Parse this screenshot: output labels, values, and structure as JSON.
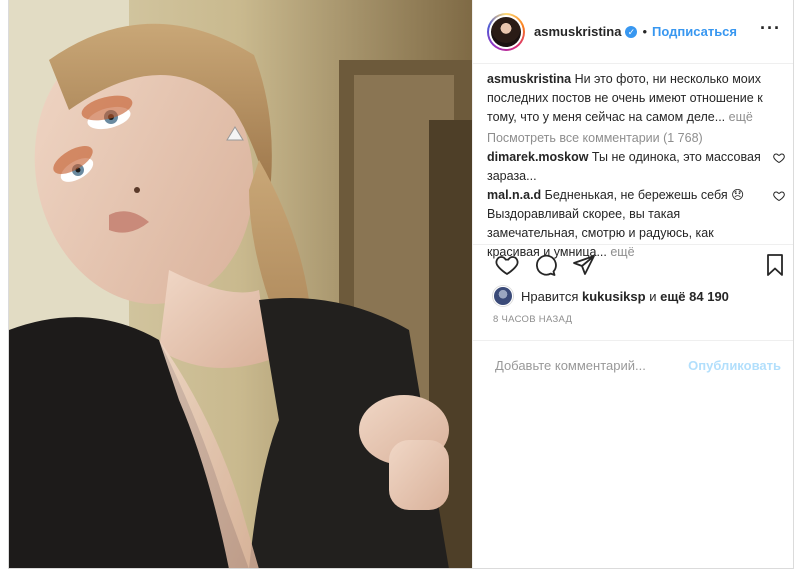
{
  "post": {
    "username": "asmuskristina",
    "verified_icon": "verified-badge-icon",
    "separator": "•",
    "follow_label": "Подписаться",
    "more_options": "···",
    "caption_user": "asmuskristina",
    "caption_text": "Ни это фото, ни несколько моих последних постов не очень имеют отношение к тому, что у меня сейчас на самом деле...",
    "caption_more": "ещё",
    "view_all_comments": "Посмотреть все комментарии (1 768)",
    "comments": [
      {
        "user": "dimarek.moskow",
        "text": "Ты не одинока, это массовая зараза...",
        "more": ""
      },
      {
        "user": "mal.n.a.d",
        "text": "Бедненькая, не бережешь себя 😞 Выздоравливай скорее, вы такая замечательная, смотрю и радуюсь, как красивая и умница...",
        "more": "ещё"
      }
    ],
    "likes_prefix": "Нравится",
    "likes_user": "kukusiksp",
    "likes_mid": "и",
    "likes_count": "ещё 84 190",
    "timestamp": "8 ЧАСОВ НАЗАД",
    "comment_placeholder": "Добавьте комментарий...",
    "publish_label": "Опубликовать"
  },
  "colors": {
    "accent": "#3897f0",
    "muted": "#8e8e8e",
    "publish_disabled": "#b2dffc"
  }
}
